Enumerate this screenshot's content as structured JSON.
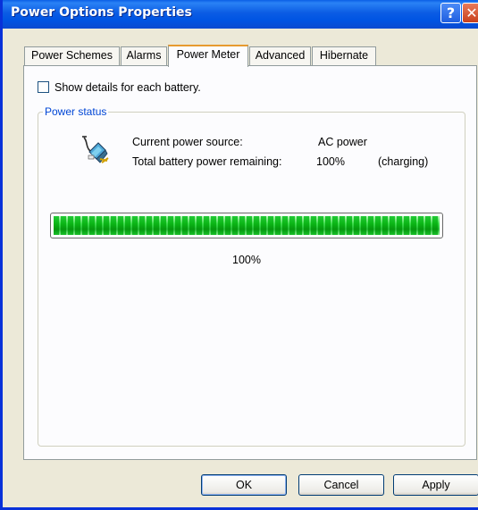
{
  "window": {
    "title": "Power Options Properties"
  },
  "caption_buttons": {
    "help": "?",
    "close": "✕"
  },
  "tabs": [
    {
      "label": "Power Schemes"
    },
    {
      "label": "Alarms"
    },
    {
      "label": "Power Meter",
      "active": true
    },
    {
      "label": "Advanced"
    },
    {
      "label": "Hibernate"
    }
  ],
  "options": {
    "show_details_label": "Show details for each battery.",
    "show_details_checked": false
  },
  "power_status": {
    "group_label": "Power status",
    "icon": "power-plug-battery-icon",
    "source_label": "Current power source:",
    "source_value": "AC power",
    "remaining_label": "Total battery power remaining:",
    "remaining_value": "100%",
    "remaining_state": "(charging)",
    "meter_level": 1.0,
    "meter_percent_label": "100%"
  },
  "buttons": {
    "ok": "OK",
    "cancel": "Cancel",
    "apply": "Apply"
  },
  "colors": {
    "titlebar": "#0054e3",
    "active_tab_accent": "#e79a2f",
    "meter_green": "#2fd24a",
    "group_label": "#0046d5"
  }
}
